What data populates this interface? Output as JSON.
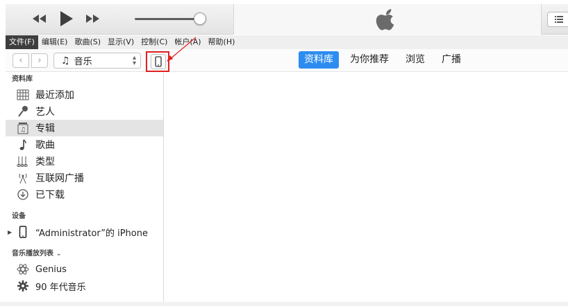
{
  "menubar": {
    "items": [
      "文件(F)",
      "编辑(E)",
      "歌曲(S)",
      "显示(V)",
      "控制(C)",
      "帐户(A)",
      "帮助(H)"
    ]
  },
  "toolbar": {
    "media_select": "音乐",
    "tabs": [
      "资料库",
      "为你推荐",
      "浏览",
      "广播"
    ]
  },
  "sidebar": {
    "library_header": "资料库",
    "library_items": [
      {
        "label": "最近添加",
        "icon": "calendar-grid-icon"
      },
      {
        "label": "艺人",
        "icon": "microphone-icon"
      },
      {
        "label": "专辑",
        "icon": "album-icon"
      },
      {
        "label": "歌曲",
        "icon": "music-note-icon"
      },
      {
        "label": "类型",
        "icon": "genre-icon"
      },
      {
        "label": "互联网广播",
        "icon": "antenna-icon"
      },
      {
        "label": "已下载",
        "icon": "download-icon"
      }
    ],
    "devices_header": "设备",
    "device_name": "“Administrator”的 iPhone",
    "playlists_header": "音乐播放列表",
    "playlists": [
      {
        "label": "Genius",
        "icon": "genius-icon"
      },
      {
        "label": "90 年代音乐",
        "icon": "gear-icon"
      }
    ]
  },
  "colors": {
    "accent": "#2d8cf0",
    "highlight_box": "#e02020",
    "menu_active_bg": "#3e3e3e",
    "selected_row": "#e4e4e4"
  }
}
